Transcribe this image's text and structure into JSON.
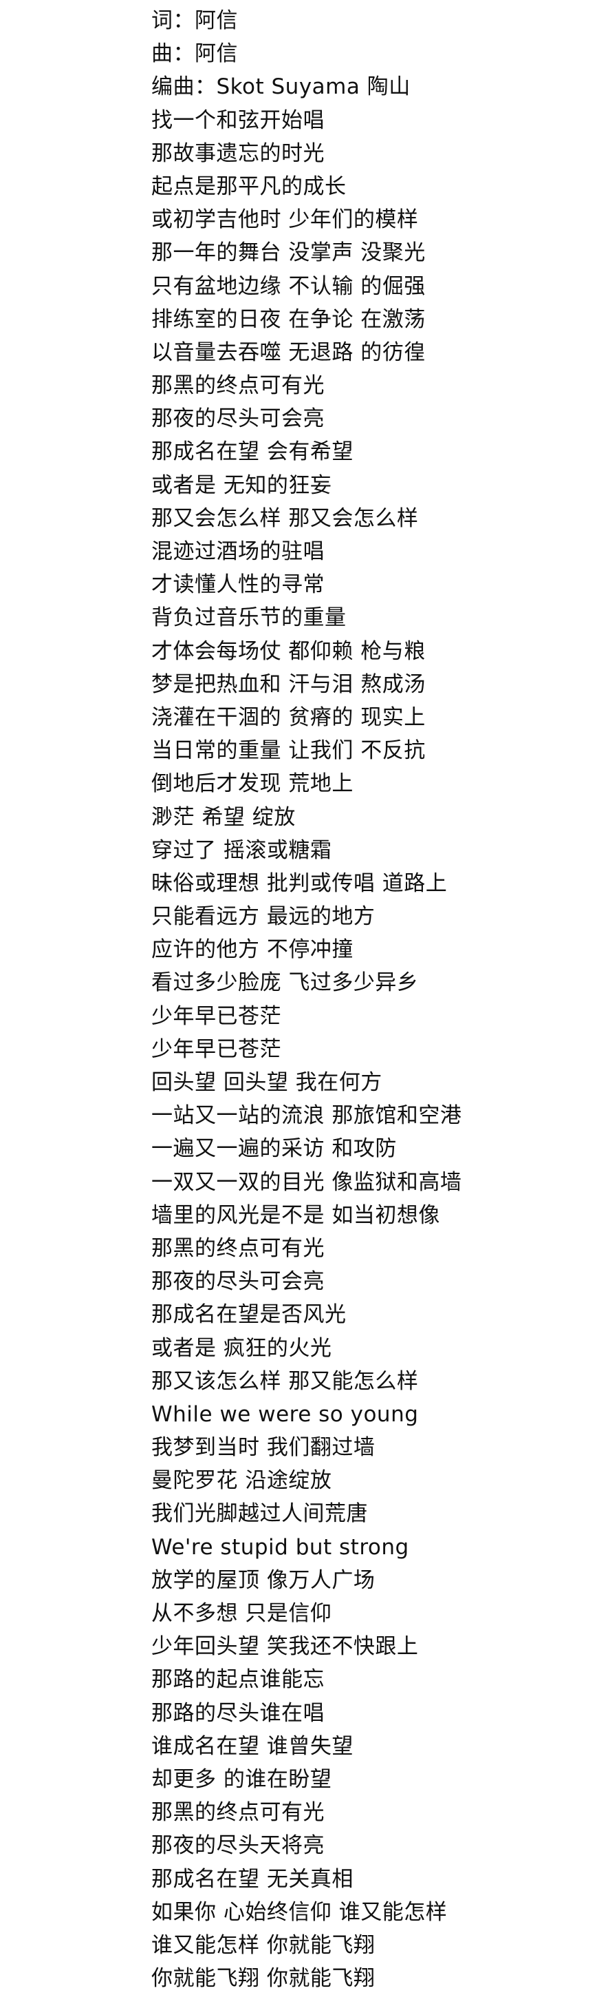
{
  "lyrics": [
    "词：阿信",
    "曲：阿信",
    "编曲：Skot Suyama 陶山",
    "找一个和弦开始唱",
    "那故事遗忘的时光",
    "起点是那平凡的成长",
    "或初学吉他时 少年们的模样",
    "那一年的舞台 没掌声 没聚光",
    "只有盆地边缘 不认输 的倔强",
    "排练室的日夜 在争论 在激荡",
    "以音量去吞噬 无退路 的彷徨",
    "那黑的终点可有光",
    "那夜的尽头可会亮",
    "那成名在望 会有希望",
    "或者是 无知的狂妄",
    "那又会怎么样 那又会怎么样",
    "混迹过酒场的驻唱",
    "才读懂人性的寻常",
    "背负过音乐节的重量",
    "才体会每场仗 都仰赖 枪与粮",
    "梦是把热血和 汗与泪 熬成汤",
    "浇灌在干涸的 贫瘠的 现实上",
    "当日常的重量 让我们 不反抗",
    "倒地后才发现 荒地上",
    "渺茫 希望 绽放",
    "穿过了 摇滚或糖霜",
    "昧俗或理想 批判或传唱 道路上",
    "只能看远方 最远的地方",
    "应许的他方 不停冲撞",
    "看过多少脸庞 飞过多少异乡",
    "少年早已苍茫",
    "少年早已苍茫",
    "回头望 回头望 我在何方",
    "一站又一站的流浪 那旅馆和空港",
    "一遍又一遍的采访 和攻防",
    "一双又一双的目光 像监狱和高墙",
    "墙里的风光是不是 如当初想像",
    "那黑的终点可有光",
    "那夜的尽头可会亮",
    "那成名在望是否风光",
    "或者是 疯狂的火光",
    "那又该怎么样 那又能怎么样",
    "While we were so young",
    "我梦到当时 我们翻过墙",
    "曼陀罗花 沿途绽放",
    "我们光脚越过人间荒唐",
    "We're stupid but strong",
    "放学的屋顶 像万人广场",
    "从不多想 只是信仰",
    "少年回头望 笑我还不快跟上",
    "那路的起点谁能忘",
    "那路的尽头谁在唱",
    "谁成名在望 谁曾失望",
    "却更多 的谁在盼望",
    "那黑的终点可有光",
    "那夜的尽头天将亮",
    "那成名在望 无关真相",
    "如果你 心始终信仰 谁又能怎样",
    "谁又能怎样 你就能飞翔",
    "你就能飞翔 你就能飞翔"
  ]
}
